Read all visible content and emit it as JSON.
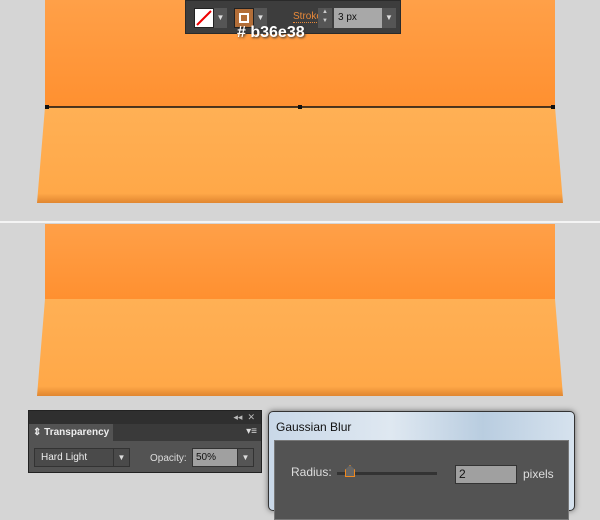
{
  "toolbar": {
    "fill_icon": "no-fill-swatch",
    "stroke_color": "#b36e38",
    "stroke_label": "Stroke:",
    "stroke_weight": "3 px"
  },
  "annotation": {
    "hex": "# b36e38"
  },
  "colors": {
    "orange_top": "#ff9a3c",
    "orange_bottom": "#ffb25a",
    "background": "#d5d5d5"
  },
  "transparency": {
    "collapse": "◂◂",
    "close": "✕",
    "tab": "⇕ Transparency",
    "menu": "▾≡",
    "blend_mode": "Hard Light",
    "opacity_label": "Opacity:",
    "opacity": "50%"
  },
  "gaussian": {
    "title": "Gaussian Blur",
    "radius_label": "Radius:",
    "radius": "2",
    "unit": "pixels"
  }
}
